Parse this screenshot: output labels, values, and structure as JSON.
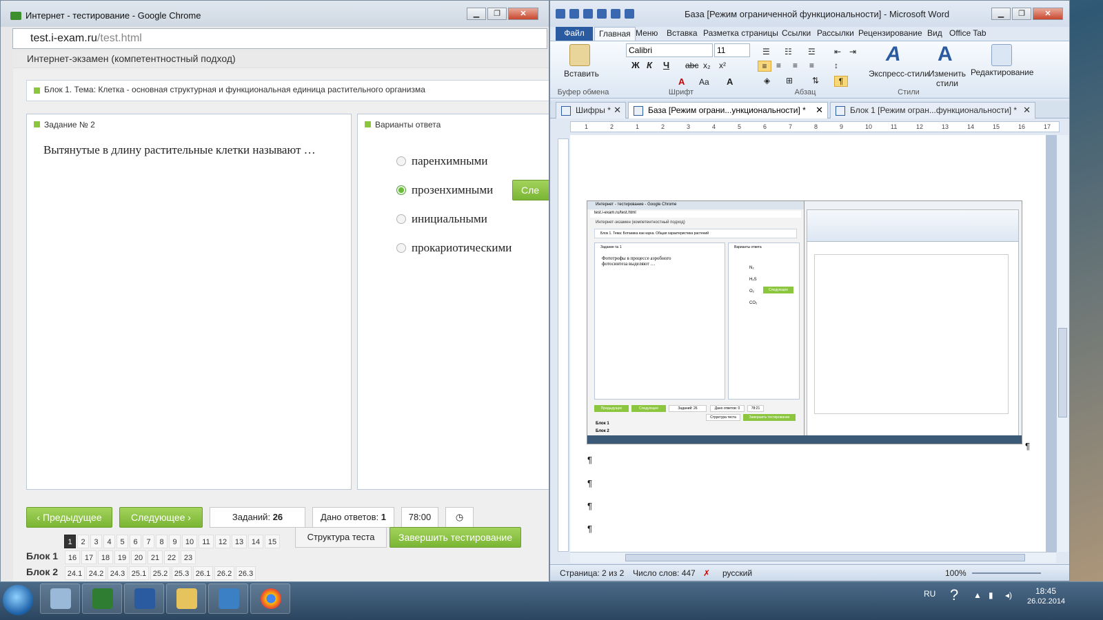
{
  "chrome": {
    "title": "Интернет - тестирование - Google Chrome",
    "url_host": "test.i-exam.ru",
    "url_path": "/test.html",
    "exam_header": "Интернет-экзамен (компетентностный подход)",
    "topic": "Блок 1. Тема: Клетка - основная структурная и функциональная единица растительного организма",
    "task_label": "Задание № 2",
    "question": "Вытянутые в длину растительные клетки называют …",
    "answers_label": "Варианты ответа",
    "options": [
      "паренхимными",
      "прозенхимными",
      "инициальными",
      "прокариотическими"
    ],
    "selected_option": 1,
    "next_partial": "Сле",
    "prev_btn": "Предыдущее",
    "next_btn": "Следующее",
    "tasks_label": "Заданий:",
    "tasks_count": "26",
    "answered_label": "Дано ответов:",
    "answered_count": "1",
    "timer": "78:00",
    "structure_btn": "Структура теста",
    "finish_btn": "Завершить тестирование",
    "nav_row1": [
      "1",
      "2",
      "3",
      "4",
      "5",
      "6",
      "7",
      "8",
      "9",
      "10",
      "11",
      "12",
      "13",
      "14",
      "15"
    ],
    "nav_current": "1",
    "block1_label": "Блок 1",
    "nav_block1": [
      "16",
      "17",
      "18",
      "19",
      "20",
      "21",
      "22",
      "23"
    ],
    "block2_label": "Блок 2",
    "nav_block2": [
      "24.1",
      "24.2",
      "24.3",
      "25.1",
      "25.2",
      "25.3",
      "26.1",
      "26.2",
      "26.3"
    ]
  },
  "word": {
    "title": "База [Режим ограниченной функциональности]  -  Microsoft Word",
    "tabs": [
      "Файл",
      "Главная",
      "Меню",
      "Вставка",
      "Разметка страницы",
      "Ссылки",
      "Рассылки",
      "Рецензирование",
      "Вид",
      "Office Tab"
    ],
    "font": "Calibri",
    "size": "11",
    "paste": "Вставить",
    "express_styles": "Экспресс-стили",
    "change_styles": "Изменить стили",
    "editing": "Редактирование",
    "groups": [
      "Буфер обмена",
      "Шрифт",
      "Абзац",
      "Стили"
    ],
    "doc_tabs": [
      "Шифры *",
      "База [Режим ограни...ункциональности] *",
      "Блок 1 [Режим огран...функциональности] *"
    ],
    "ruler_marks": [
      "1",
      "2",
      "1",
      "2",
      "3",
      "4",
      "5",
      "6",
      "7",
      "8",
      "9",
      "10",
      "11",
      "12",
      "13",
      "14",
      "15",
      "16",
      "17"
    ],
    "pilcrow": "¶",
    "status_page": "Страница: 2 из 2",
    "status_words": "Число слов: 447",
    "status_lang": "русский",
    "zoom": "100%"
  },
  "embedded": {
    "chrome_title": "Интернет - тестирование - Google Chrome",
    "url": "test.i-exam.ru/test.html",
    "exam_header": "Интернет-экзамен (компетентностный подход)",
    "topic": "Блок 1. Тема: Ботаника как наука. Общая характеристика растений",
    "task_label": "Задание № 1",
    "question": "Фототрофы в процессе аэробного фотосинтеза выделяют …",
    "answers_label": "Варианты ответа",
    "options": [
      "N₂",
      "H₂S",
      "O₂",
      "CO₂"
    ],
    "next_label": "Следующее",
    "prev_btn": "Предыдущее",
    "tasks": "Заданий: 26",
    "answered": "Дано ответов: 0",
    "timer": "78:21",
    "structure": "Структура теста",
    "finish": "Завершить тестирование",
    "block1": "Блок 1",
    "block2": "Блок 2"
  },
  "taskbar": {
    "lang": "RU",
    "time": "18:45",
    "date": "26.02.2014"
  },
  "colors": {
    "accent_green": "#8cc63e",
    "word_blue": "#2a5aa0"
  }
}
